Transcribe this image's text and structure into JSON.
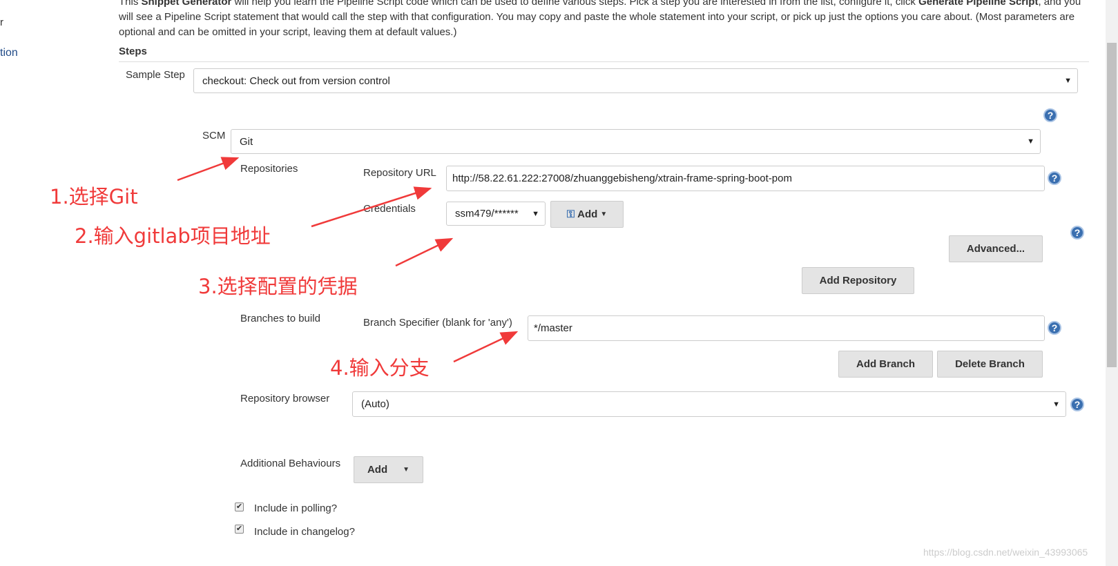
{
  "sidebar": {
    "fragment1": "r",
    "fragment2": "tion"
  },
  "intro": {
    "pre": "This ",
    "bold1": "Snippet Generator",
    "mid1": " will help you learn the Pipeline Script code which can be used to define various steps. Pick a step you are interested in from the list, configure it, click ",
    "bold2": "Generate Pipeline Script",
    "rest": ", and you will see a Pipeline Script statement that would call the step with that configuration. You may copy and paste the whole statement into your script, or pick up just the options you care about. (Most parameters are optional and can be omitted in your script, leaving them at default values.)"
  },
  "steps": {
    "heading": "Steps",
    "sample_step_label": "Sample Step",
    "sample_step_value": "checkout: Check out from version control"
  },
  "scm": {
    "label": "SCM",
    "value": "Git"
  },
  "repositories": {
    "label": "Repositories",
    "url_label": "Repository URL",
    "url_value": "http://58.22.61.222:27008/zhuanggebisheng/xtrain-frame-spring-boot-pom",
    "credentials_label": "Credentials",
    "credentials_value": "ssm479/******",
    "add_label": "Add",
    "advanced_label": "Advanced...",
    "add_repository_label": "Add Repository"
  },
  "branches": {
    "label": "Branches to build",
    "specifier_label": "Branch Specifier (blank for 'any')",
    "specifier_value": "*/master",
    "add_branch_label": "Add Branch",
    "delete_branch_label": "Delete Branch"
  },
  "browser": {
    "label": "Repository browser",
    "value": "(Auto)"
  },
  "behaviours": {
    "label": "Additional Behaviours",
    "add_label": "Add"
  },
  "checkboxes": [
    {
      "label": "Include in polling?",
      "checked": true
    },
    {
      "label": "Include in changelog?",
      "checked": true
    }
  ],
  "annotations": [
    "1.选择Git",
    "2.输入gitlab项目地址",
    "3.选择配置的凭据",
    "4.输入分支"
  ],
  "watermark": "https://blog.csdn.net/weixin_43993065",
  "colors": {
    "annotation": "#f03a3a",
    "help_icon": "#3a6fb0",
    "button": "#e4e4e4"
  }
}
